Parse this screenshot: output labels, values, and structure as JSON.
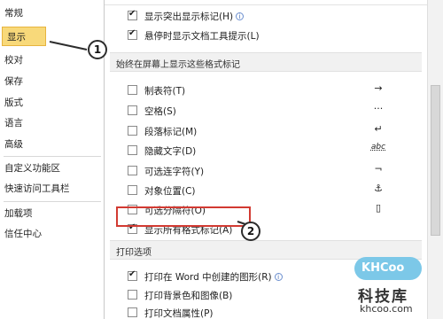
{
  "sidebar": {
    "items": [
      {
        "label": "常规"
      },
      {
        "label": "显示"
      },
      {
        "label": "校对"
      },
      {
        "label": "保存"
      },
      {
        "label": "版式"
      },
      {
        "label": "语言"
      },
      {
        "label": "高级"
      },
      {
        "label": "自定义功能区"
      },
      {
        "label": "快速访问工具栏"
      },
      {
        "label": "加载项"
      },
      {
        "label": "信任中心"
      }
    ]
  },
  "content": {
    "top_options": [
      {
        "label": "显示突出显示标记(H)",
        "checked": true,
        "info_icon": "info-icon"
      },
      {
        "label": "悬停时显示文档工具提示(L)",
        "checked": true
      }
    ],
    "section_marks": {
      "title": "始终在屏幕上显示这些格式标记",
      "items": [
        {
          "label": "制表符(T)",
          "checked": false,
          "symbol": "→"
        },
        {
          "label": "空格(S)",
          "checked": false,
          "symbol": "···"
        },
        {
          "label": "段落标记(M)",
          "checked": false,
          "symbol": "↵"
        },
        {
          "label": "隐藏文字(D)",
          "checked": false,
          "symbol": "abc"
        },
        {
          "label": "可选连字符(Y)",
          "checked": false,
          "symbol": "¬"
        },
        {
          "label": "对象位置(C)",
          "checked": false,
          "symbol": "⚓"
        },
        {
          "label": "可选分隔符(O)",
          "checked": false,
          "symbol": "▯"
        },
        {
          "label": "显示所有格式标记(A)",
          "checked": true
        }
      ]
    },
    "section_print": {
      "title": "打印选项",
      "items": [
        {
          "label": "打印在 Word 中创建的图形(R)",
          "checked": true,
          "info_icon": "info-icon"
        },
        {
          "label": "打印背景色和图像(B)",
          "checked": false
        },
        {
          "label": "打印文档属性(P)",
          "checked": false
        }
      ]
    }
  },
  "callouts": {
    "one": "1",
    "two": "2"
  },
  "watermark": {
    "logo": "KHCoo",
    "cn": "科技库",
    "url": "khcoo.com"
  },
  "colors": {
    "selected_bg": "#f8d97a",
    "highlight_border": "#d23a32"
  }
}
